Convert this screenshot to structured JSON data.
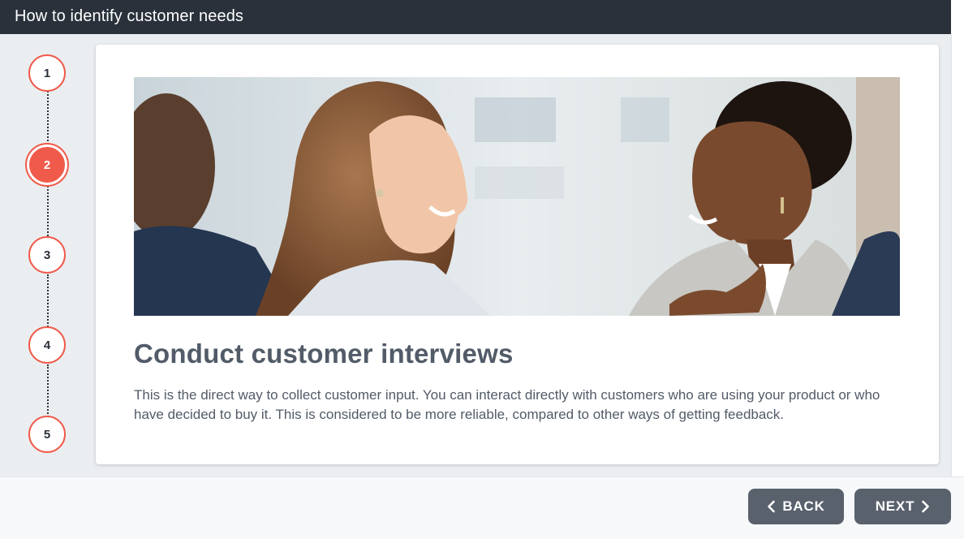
{
  "header": {
    "title": "How to identify customer needs"
  },
  "stepper": {
    "steps": [
      "1",
      "2",
      "3",
      "4",
      "5"
    ],
    "active_step": "2"
  },
  "content": {
    "image_description_icon": "photo-two-women-talking",
    "heading": "Conduct customer interviews",
    "body": "This is the direct way to collect customer input. You can interact directly with customers who are using your product or who have decided to buy it. This is considered to be more reliable, compared to other ways of getting feedback."
  },
  "footer": {
    "back_label": "BACK",
    "next_label": "NEXT",
    "back_icon": "chevron-left-icon",
    "next_icon": "chevron-right-icon"
  },
  "colors": {
    "header_bg": "#2a313b",
    "accent": "#f05a4a",
    "button_bg": "#59616d",
    "text": "#525b68",
    "stage_bg": "#ebeef1"
  }
}
